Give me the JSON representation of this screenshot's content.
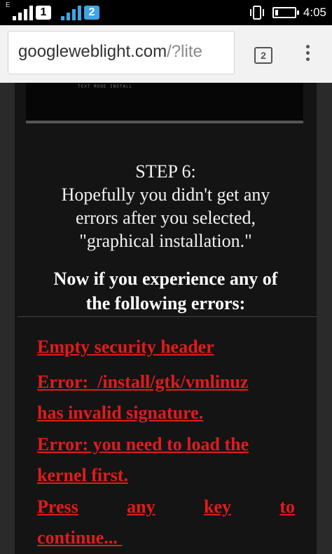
{
  "status_bar": {
    "network_type": "E",
    "sim1": "1",
    "sim2": "2",
    "time": "4:05"
  },
  "browser": {
    "url_host": "googleweblight.com",
    "url_rest": "/?lite",
    "tab_count": "2"
  },
  "video": {
    "caption": "TEXT MODE INSTALL"
  },
  "article": {
    "step_title": "STEP 6:",
    "step_lines": [
      "Hopefully you didn't get any",
      "errors after you selected,",
      "\"graphical installation.\""
    ],
    "warning_lines": [
      "Now if you experience any of",
      "the following errors:"
    ],
    "errors": [
      "Empty security header",
      "Error: /install/gtk/vmlinuz has invalid signature.",
      "Error: you need to load the kernel first.",
      "Press any key to continue..."
    ],
    "error_lines": {
      "e2a": "Error:  /install/gtk/vmlinuz",
      "e2b": "has invalid signature.",
      "e3a": "Error: you need to load the",
      "e3b": "kernel first.",
      "e4_words": [
        "Press",
        "any",
        "key",
        "to"
      ],
      "e4b": "continue... "
    }
  }
}
